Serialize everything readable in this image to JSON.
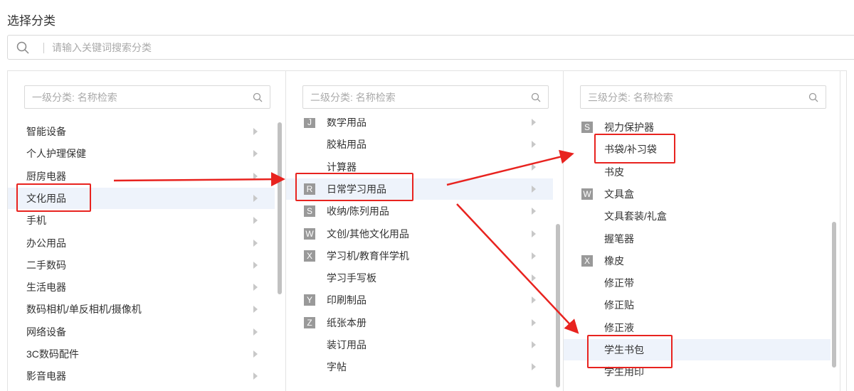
{
  "title": "选择分类",
  "search": {
    "placeholder": "请输入关键词搜索分类"
  },
  "columns": [
    {
      "search_placeholder": "一级分类: 名称检索",
      "items": [
        {
          "label": "智能设备",
          "arrow": true
        },
        {
          "label": "个人护理保健",
          "arrow": true
        },
        {
          "label": "厨房电器",
          "arrow": true
        },
        {
          "label": "文化用品",
          "arrow": true,
          "active": true
        },
        {
          "label": "手机",
          "arrow": true
        },
        {
          "label": "办公用品",
          "arrow": true
        },
        {
          "label": "二手数码",
          "arrow": true
        },
        {
          "label": "生活电器",
          "arrow": true
        },
        {
          "label": "数码相机/单反相机/摄像机",
          "arrow": true
        },
        {
          "label": "网络设备",
          "arrow": true
        },
        {
          "label": "3C数码配件",
          "arrow": true
        },
        {
          "label": "影音电器",
          "arrow": true
        }
      ]
    },
    {
      "search_placeholder": "二级分类: 名称检索",
      "items": [
        {
          "letter": "J",
          "label": "数学用品",
          "arrow": true
        },
        {
          "label": "胶粘用品",
          "arrow": true
        },
        {
          "label": "计算器",
          "arrow": true
        },
        {
          "letter": "R",
          "label": "日常学习用品",
          "arrow": true,
          "active": true
        },
        {
          "letter": "S",
          "label": "收纳/陈列用品",
          "arrow": true
        },
        {
          "letter": "W",
          "label": "文创/其他文化用品",
          "arrow": true
        },
        {
          "letter": "X",
          "label": "学习机/教育伴学机",
          "arrow": true
        },
        {
          "label": "学习手写板",
          "arrow": true
        },
        {
          "letter": "Y",
          "label": "印刷制品",
          "arrow": true
        },
        {
          "letter": "Z",
          "label": "纸张本册",
          "arrow": true
        },
        {
          "label": "装订用品",
          "arrow": true
        },
        {
          "label": "字帖",
          "arrow": true
        }
      ]
    },
    {
      "search_placeholder": "三级分类: 名称检索",
      "items": [
        {
          "letter": "S",
          "label": "视力保护器"
        },
        {
          "label": "书袋/补习袋"
        },
        {
          "label": "书皮"
        },
        {
          "letter": "W",
          "label": "文具盒"
        },
        {
          "label": "文具套装/礼盒"
        },
        {
          "label": "握笔器"
        },
        {
          "letter": "X",
          "label": "橡皮"
        },
        {
          "label": "修正带"
        },
        {
          "label": "修正贴"
        },
        {
          "label": "修正液"
        },
        {
          "label": "学生书包",
          "active": true
        },
        {
          "label": "学生用印"
        }
      ]
    }
  ],
  "colors": {
    "highlight": "#e8231f",
    "active_row": "#eef3fb",
    "letter_badge": "#999999"
  }
}
